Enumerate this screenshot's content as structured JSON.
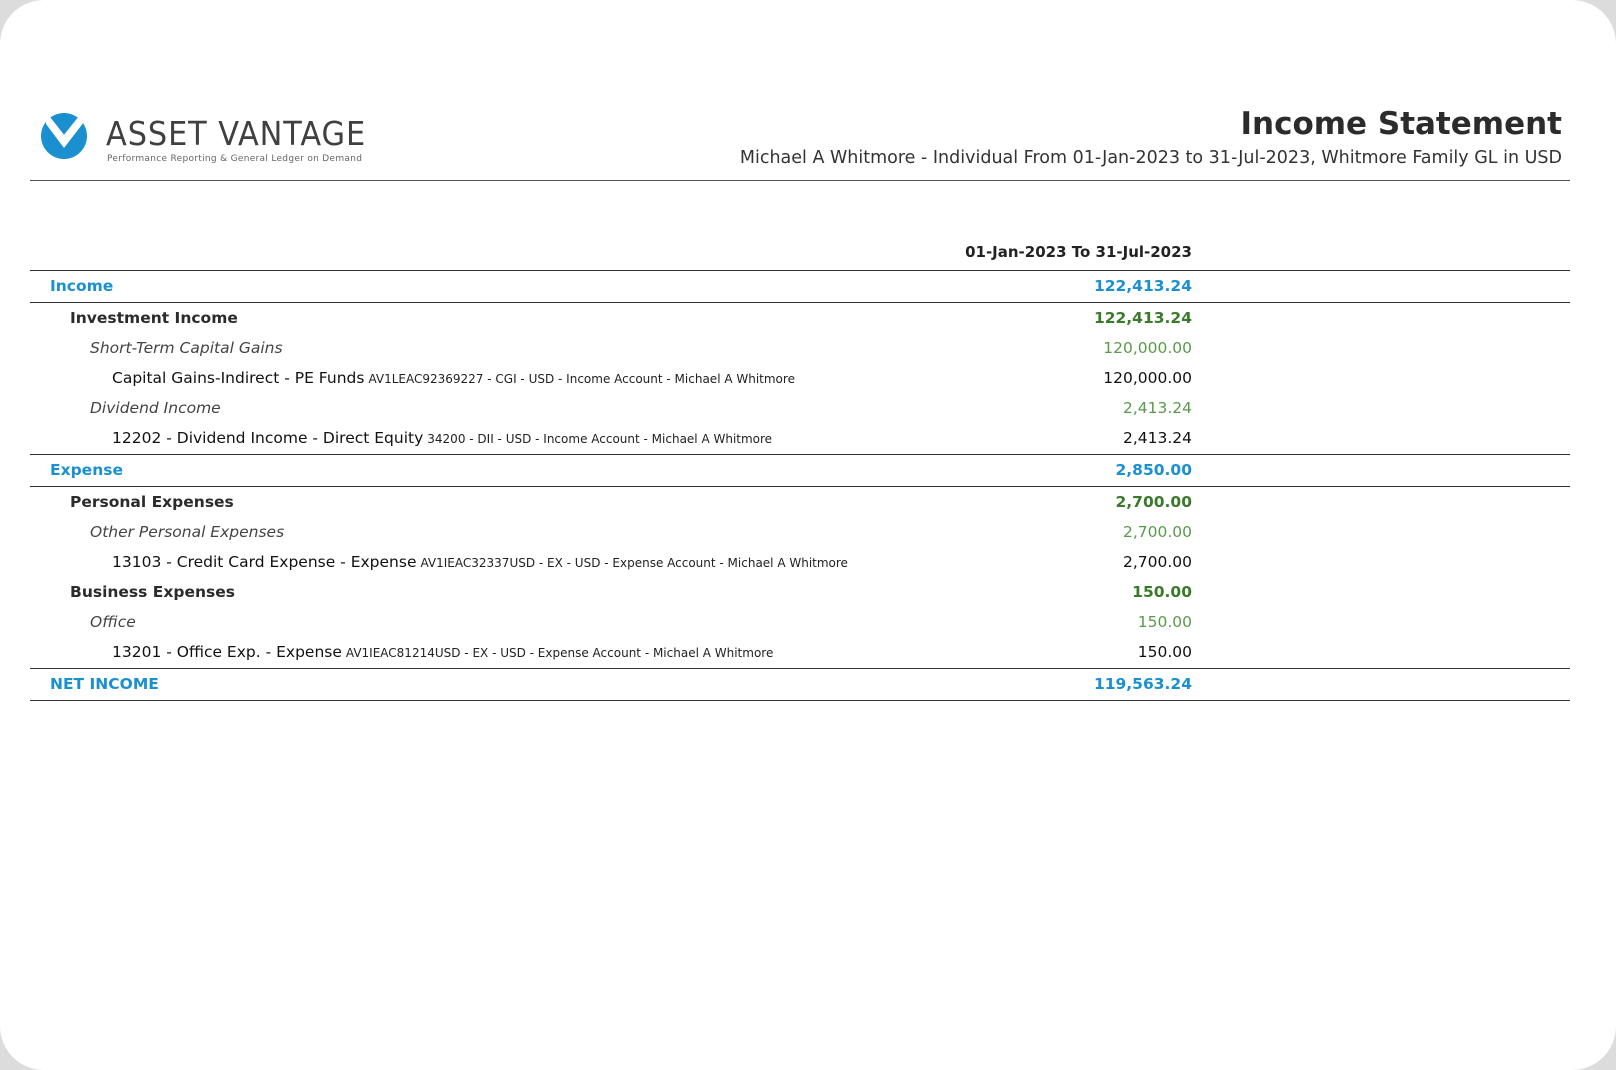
{
  "brand": {
    "name": "ASSET VANTAGE",
    "tagline": "Performance Reporting & General Ledger on Demand",
    "color": "#1a90d0"
  },
  "report": {
    "title": "Income Statement",
    "subtitle": "Michael A Whitmore - Individual From 01-Jan-2023 to 31-Jul-2023, Whitmore Family GL in USD",
    "column_header": "01-Jan-2023 To 31-Jul-2023"
  },
  "rows": [
    {
      "label": "Income",
      "meta": "",
      "amount": "122,413.24"
    },
    {
      "label": "Investment Income",
      "meta": "",
      "amount": "122,413.24"
    },
    {
      "label": "Short-Term Capital Gains",
      "meta": "",
      "amount": "120,000.00"
    },
    {
      "label": "Capital Gains-Indirect - PE Funds",
      "meta": "AV1LEAC92369227 - CGI - USD - Income Account - Michael A Whitmore",
      "amount": "120,000.00"
    },
    {
      "label": "Dividend Income",
      "meta": "",
      "amount": "2,413.24"
    },
    {
      "label": "12202 - Dividend Income - Direct Equity",
      "meta": "34200 - DII - USD - Income Account - Michael A Whitmore",
      "amount": "2,413.24"
    },
    {
      "label": "Expense",
      "meta": "",
      "amount": "2,850.00"
    },
    {
      "label": "Personal Expenses",
      "meta": "",
      "amount": "2,700.00"
    },
    {
      "label": "Other Personal Expenses",
      "meta": "",
      "amount": "2,700.00"
    },
    {
      "label": "13103 - Credit Card Expense - Expense",
      "meta": "AV1IEAC32337USD - EX - USD - Expense Account - Michael A Whitmore",
      "amount": "2,700.00"
    },
    {
      "label": "Business Expenses",
      "meta": "",
      "amount": "150.00"
    },
    {
      "label": "Office",
      "meta": "",
      "amount": "150.00"
    },
    {
      "label": "13201 - Office Exp. - Expense",
      "meta": "AV1IEAC81214USD - EX - USD - Expense Account - Michael A Whitmore",
      "amount": "150.00"
    },
    {
      "label": "NET INCOME",
      "meta": "",
      "amount": "119,563.24"
    }
  ]
}
